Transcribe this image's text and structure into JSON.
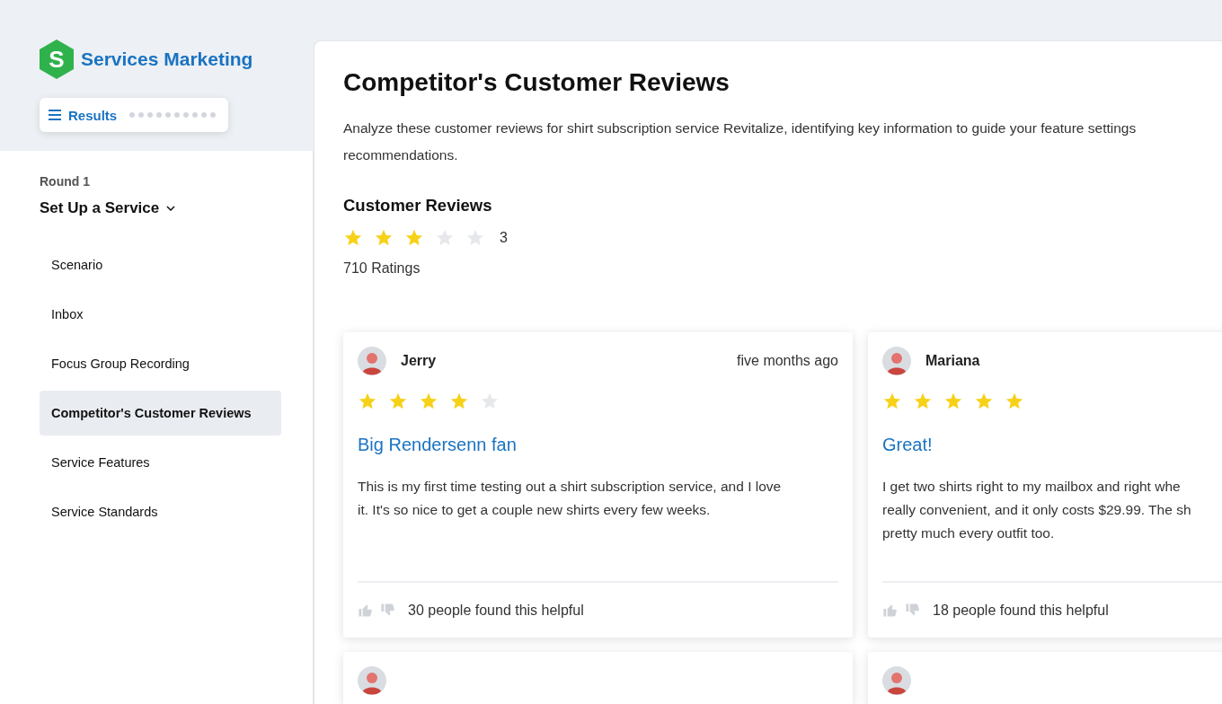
{
  "brand": {
    "name": "Services Marketing",
    "logo_letter": "S"
  },
  "results_button": {
    "label": "Results",
    "steps": [
      {
        "done": false
      },
      {
        "done": false
      },
      {
        "done": false
      },
      {
        "done": false
      },
      {
        "done": false
      },
      {
        "done": false
      },
      {
        "done": false
      },
      {
        "done": false
      },
      {
        "done": false
      },
      {
        "done": false
      }
    ]
  },
  "round": {
    "label": "Round 1",
    "title": "Set Up a Service",
    "expanded": true
  },
  "nav": [
    {
      "label": "Scenario",
      "selected": false
    },
    {
      "label": "Inbox",
      "selected": false
    },
    {
      "label": "Focus Group Recording",
      "selected": false
    },
    {
      "label": "Competitor's Customer Reviews",
      "selected": true
    },
    {
      "label": "Service Features",
      "selected": false
    },
    {
      "label": "Service Standards",
      "selected": false
    }
  ],
  "page": {
    "title": "Competitor's Customer Reviews",
    "description_lines": [
      "Analyze these customer reviews for shirt subscription service Revitalize, identifying key information to guide your feature settings",
      "recommendations."
    ]
  },
  "summary": {
    "heading": "Customer Reviews",
    "stars": 3,
    "reading": "3",
    "ratings": "710 Ratings"
  },
  "reviews": [
    {
      "name": "Jerry",
      "time": "five months ago",
      "stars": 4,
      "title": "Big Rendersenn fan",
      "body_lines": [
        "This is my first time testing out a shirt subscription service, and I love",
        "it. It's so nice to get a couple new shirts every few weeks."
      ],
      "helpful": "30 people found this helpful"
    },
    {
      "name": "Mariana",
      "stars": 5,
      "title": "Great!",
      "body_lines": [
        "I get two shirts right to my mailbox and right whe",
        "really convenient, and it only costs $29.99. The sh",
        "pretty much every outfit too."
      ],
      "helpful": "18 people found this helpful"
    }
  ]
}
